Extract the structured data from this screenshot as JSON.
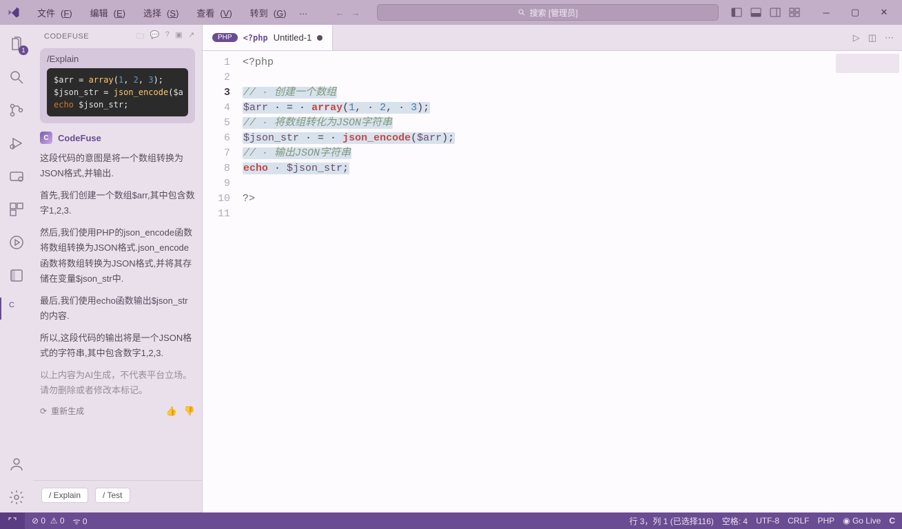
{
  "titlebar": {
    "menu": {
      "file": {
        "label": "文件",
        "hotkey": "F"
      },
      "edit": {
        "label": "编辑",
        "hotkey": "E"
      },
      "select": {
        "label": "选择",
        "hotkey": "S"
      },
      "view": {
        "label": "查看",
        "hotkey": "V"
      },
      "go": {
        "label": "转到",
        "hotkey": "G"
      },
      "more": "…"
    },
    "search_placeholder": "搜索 [管理员]"
  },
  "activity": {
    "explorer_badge": "1"
  },
  "sidebar": {
    "title": "CODEFUSE",
    "chat": {
      "command": "/Explain",
      "code_lines": [
        [
          {
            "t": "$arr",
            "c": "var"
          },
          {
            "t": " = ",
            "c": ""
          },
          {
            "t": "array",
            "c": "call"
          },
          {
            "t": "(",
            "c": ""
          },
          {
            "t": "1",
            "c": "num"
          },
          {
            "t": ", ",
            "c": ""
          },
          {
            "t": "2",
            "c": "num"
          },
          {
            "t": ", ",
            "c": ""
          },
          {
            "t": "3",
            "c": "num"
          },
          {
            "t": ");",
            "c": ""
          }
        ],
        [
          {
            "t": "$json_str",
            "c": "var"
          },
          {
            "t": " = ",
            "c": ""
          },
          {
            "t": "json_encode",
            "c": "call"
          },
          {
            "t": "(",
            "c": ""
          },
          {
            "t": "$a",
            "c": "var"
          }
        ],
        [
          {
            "t": "echo ",
            "c": "kw"
          },
          {
            "t": "$json_str",
            "c": "var"
          },
          {
            "t": ";",
            "c": ""
          }
        ]
      ]
    },
    "brand": "CodeFuse",
    "explain_paragraphs": [
      "这段代码的意图是将一个数组转换为JSON格式,并输出.",
      "首先,我们创建一个数组$arr,其中包含数字1,2,3.",
      "然后,我们使用PHP的json_encode函数将数组转换为JSON格式.json_encode函数将数组转换为JSON格式,并将其存储在变量$json_str中.",
      "最后,我们使用echo函数输出$json_str的内容.",
      "所以,这段代码的输出将是一个JSON格式的字符串,其中包含数字1,2,3."
    ],
    "disclaimer": "以上内容为AI生成，不代表平台立场。请勿删除或者修改本标记。",
    "regenerate": "重新生成",
    "chips": {
      "explain": "/ Explain",
      "test": "/ Test"
    }
  },
  "editor": {
    "tab": {
      "language": "PHP",
      "glyph": "<?php",
      "filename": "Untitled-1",
      "dirty": true
    },
    "lines": [
      {
        "n": 1,
        "selected": false,
        "tokens": [
          {
            "t": "<?php",
            "c": "tk-open"
          }
        ]
      },
      {
        "n": 2,
        "selected": false,
        "tokens": []
      },
      {
        "n": 3,
        "selected": true,
        "active": true,
        "tokens": [
          {
            "t": "// · 创建一个数组",
            "c": "tk-comment"
          }
        ]
      },
      {
        "n": 4,
        "selected": true,
        "tokens": [
          {
            "t": "$arr",
            "c": "tk-var"
          },
          {
            "t": " · ",
            "c": ""
          },
          {
            "t": "=",
            "c": "tk-op"
          },
          {
            "t": " · ",
            "c": ""
          },
          {
            "t": "array",
            "c": "tk-fn"
          },
          {
            "t": "(",
            "c": "tk-punc"
          },
          {
            "t": "1",
            "c": "tk-num"
          },
          {
            "t": ", · ",
            "c": "tk-punc"
          },
          {
            "t": "2",
            "c": "tk-num"
          },
          {
            "t": ", · ",
            "c": "tk-punc"
          },
          {
            "t": "3",
            "c": "tk-num"
          },
          {
            "t": ");",
            "c": "tk-punc"
          }
        ]
      },
      {
        "n": 5,
        "selected": true,
        "tokens": [
          {
            "t": "// · 将数组转化为JSON字符串",
            "c": "tk-comment"
          }
        ]
      },
      {
        "n": 6,
        "selected": true,
        "tokens": [
          {
            "t": "$json_str",
            "c": "tk-var"
          },
          {
            "t": " · ",
            "c": ""
          },
          {
            "t": "=",
            "c": "tk-op"
          },
          {
            "t": " · ",
            "c": ""
          },
          {
            "t": "json_encode",
            "c": "tk-fn"
          },
          {
            "t": "(",
            "c": "tk-punc"
          },
          {
            "t": "$arr",
            "c": "tk-var"
          },
          {
            "t": ");",
            "c": "tk-punc"
          }
        ]
      },
      {
        "n": 7,
        "selected": true,
        "tokens": [
          {
            "t": "// · 输出JSON字符串",
            "c": "tk-comment"
          }
        ]
      },
      {
        "n": 8,
        "selected": true,
        "tokens": [
          {
            "t": "echo",
            "c": "tk-kw"
          },
          {
            "t": " · ",
            "c": ""
          },
          {
            "t": "$json_str",
            "c": "tk-var"
          },
          {
            "t": ";",
            "c": "tk-punc"
          }
        ]
      },
      {
        "n": 9,
        "selected": false,
        "tokens": []
      },
      {
        "n": 10,
        "selected": false,
        "tokens": [
          {
            "t": "?>",
            "c": "tk-open"
          }
        ]
      },
      {
        "n": 11,
        "selected": false,
        "tokens": []
      }
    ]
  },
  "status": {
    "problems": "0",
    "warnings": "0",
    "ports": "0",
    "cursor": "行 3，列 1 (已选择116)",
    "indent": "空格: 4",
    "encoding": "UTF-8",
    "eol": "CRLF",
    "language": "PHP",
    "golive": "Go Live"
  }
}
